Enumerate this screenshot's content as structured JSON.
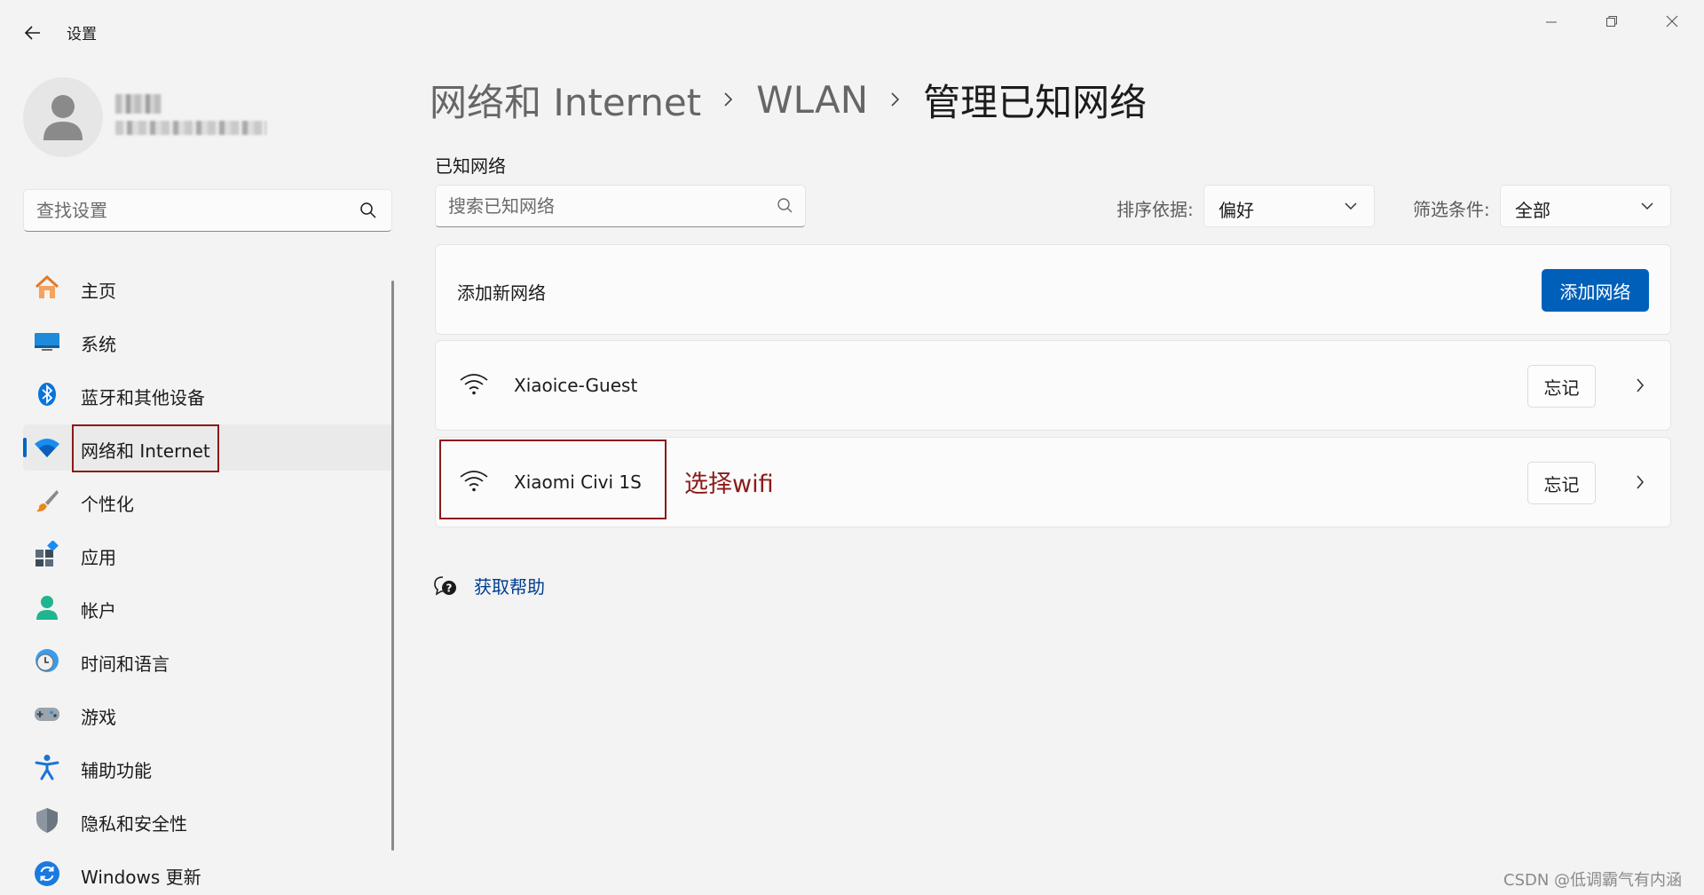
{
  "window": {
    "title": "设置",
    "icons": {
      "back": "back-arrow-icon",
      "minimize": "minimize-icon",
      "maximize": "restore-icon",
      "close": "close-icon"
    }
  },
  "sidebar": {
    "search": {
      "placeholder": "查找设置",
      "value": ""
    },
    "items": [
      {
        "label": "主页",
        "icon": "home-icon",
        "active": false
      },
      {
        "label": "系统",
        "icon": "system-display-icon",
        "active": false
      },
      {
        "label": "蓝牙和其他设备",
        "icon": "bluetooth-icon",
        "active": false
      },
      {
        "label": "网络和 Internet",
        "icon": "wifi-network-icon",
        "active": true
      },
      {
        "label": "个性化",
        "icon": "brush-icon",
        "active": false
      },
      {
        "label": "应用",
        "icon": "apps-icon",
        "active": false
      },
      {
        "label": "帐户",
        "icon": "account-icon",
        "active": false
      },
      {
        "label": "时间和语言",
        "icon": "clock-globe-icon",
        "active": false
      },
      {
        "label": "游戏",
        "icon": "gamepad-icon",
        "active": false
      },
      {
        "label": "辅助功能",
        "icon": "accessibility-icon",
        "active": false
      },
      {
        "label": "隐私和安全性",
        "icon": "shield-icon",
        "active": false
      },
      {
        "label": "Windows 更新",
        "icon": "update-icon",
        "active": false
      }
    ]
  },
  "breadcrumb": {
    "items": [
      "网络和 Internet",
      "WLAN"
    ],
    "current": "管理已知网络"
  },
  "main": {
    "section_label": "已知网络",
    "search": {
      "placeholder": "搜索已知网络",
      "value": ""
    },
    "sort": {
      "label": "排序依据:",
      "value": "偏好"
    },
    "filter": {
      "label": "筛选条件:",
      "value": "全部"
    },
    "add_card": {
      "text": "添加新网络",
      "button": "添加网络"
    },
    "networks": [
      {
        "name": "Xiaoice-Guest",
        "forget": "忘记"
      },
      {
        "name": "Xiaomi Civi 1S",
        "forget": "忘记"
      }
    ],
    "annotation": "选择wifi",
    "help": "获取帮助"
  },
  "watermark": "CSDN @低调霸气有内涵",
  "colors": {
    "accent": "#005fb8",
    "highlight": "#8b1a1a",
    "link": "#003e92"
  }
}
